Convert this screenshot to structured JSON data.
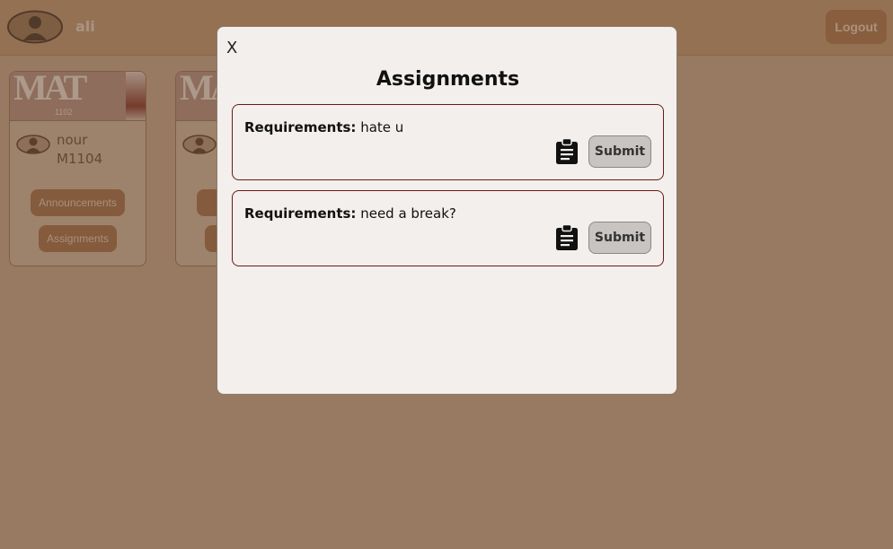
{
  "header": {
    "username": "ali",
    "logout_label": "Logout"
  },
  "courses": [
    {
      "banner_text": "MAT",
      "banner_code": "1102",
      "teacher": "nour",
      "course_code": "M1104",
      "announcements_label": "Announcements",
      "assignments_label": "Assignments"
    }
  ],
  "modal": {
    "close_label": "X",
    "title": "Assignments",
    "requirements_label": "Requirements:",
    "items": [
      {
        "requirement": "hate u",
        "submit_label": "Submit"
      },
      {
        "requirement": "need a break?",
        "submit_label": "Submit"
      }
    ]
  },
  "icons": {
    "avatar": "user-avatar-icon",
    "assignment": "clipboard-icon"
  },
  "colors": {
    "topbar": "#c59d7b",
    "page_bg": "#c9ad94",
    "accent_button": "#a87552",
    "modal_bg": "#f3efec",
    "assignment_border": "#6b1a14"
  }
}
